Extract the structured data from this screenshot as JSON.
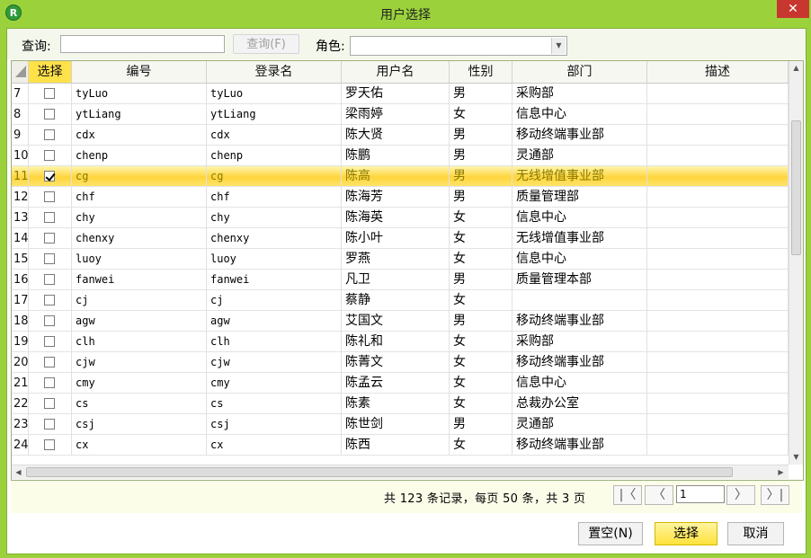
{
  "window": {
    "title": "用户选择",
    "close_glyph": "✕",
    "app_icon_glyph": "R"
  },
  "toolbar": {
    "query_label": "查询:",
    "query_value": "",
    "query_button": "查询(F)",
    "role_label": "角色:",
    "role_value": ""
  },
  "grid": {
    "columns": [
      "选择",
      "编号",
      "登录名",
      "用户名",
      "性别",
      "部门",
      "描述"
    ],
    "rows": [
      {
        "idx": "7",
        "checked": false,
        "id": "tyLuo",
        "login": "tyLuo",
        "name": "罗天佑",
        "gender": "男",
        "dept": "采购部",
        "desc": ""
      },
      {
        "idx": "8",
        "checked": false,
        "id": "ytLiang",
        "login": "ytLiang",
        "name": "梁雨婷",
        "gender": "女",
        "dept": "信息中心",
        "desc": ""
      },
      {
        "idx": "9",
        "checked": false,
        "id": "cdx",
        "login": "cdx",
        "name": "陈大贤",
        "gender": "男",
        "dept": "移动终端事业部",
        "desc": ""
      },
      {
        "idx": "10",
        "checked": false,
        "id": "chenp",
        "login": "chenp",
        "name": "陈鹏",
        "gender": "男",
        "dept": "灵通部",
        "desc": ""
      },
      {
        "idx": "11",
        "checked": true,
        "selected": true,
        "id": "cg",
        "login": "cg",
        "name": "陈高",
        "gender": "男",
        "dept": "无线增值事业部",
        "desc": ""
      },
      {
        "idx": "12",
        "checked": false,
        "id": "chf",
        "login": "chf",
        "name": "陈海芳",
        "gender": "男",
        "dept": "质量管理部",
        "desc": ""
      },
      {
        "idx": "13",
        "checked": false,
        "id": "chy",
        "login": "chy",
        "name": "陈海英",
        "gender": "女",
        "dept": "信息中心",
        "desc": ""
      },
      {
        "idx": "14",
        "checked": false,
        "id": "chenxy",
        "login": "chenxy",
        "name": "陈小叶",
        "gender": "女",
        "dept": "无线增值事业部",
        "desc": ""
      },
      {
        "idx": "15",
        "checked": false,
        "id": "luoy",
        "login": "luoy",
        "name": "罗燕",
        "gender": "女",
        "dept": "信息中心",
        "desc": ""
      },
      {
        "idx": "16",
        "checked": false,
        "id": "fanwei",
        "login": "fanwei",
        "name": "凡卫",
        "gender": "男",
        "dept": "质量管理本部",
        "desc": ""
      },
      {
        "idx": "17",
        "checked": false,
        "id": "cj",
        "login": "cj",
        "name": "蔡静",
        "gender": "女",
        "dept": "",
        "desc": ""
      },
      {
        "idx": "18",
        "checked": false,
        "id": "agw",
        "login": "agw",
        "name": "艾国文",
        "gender": "男",
        "dept": "移动终端事业部",
        "desc": ""
      },
      {
        "idx": "19",
        "checked": false,
        "id": "clh",
        "login": "clh",
        "name": "陈礼和",
        "gender": "女",
        "dept": "采购部",
        "desc": ""
      },
      {
        "idx": "20",
        "checked": false,
        "id": "cjw",
        "login": "cjw",
        "name": "陈菁文",
        "gender": "女",
        "dept": "移动终端事业部",
        "desc": ""
      },
      {
        "idx": "21",
        "checked": false,
        "id": "cmy",
        "login": "cmy",
        "name": "陈孟云",
        "gender": "女",
        "dept": "信息中心",
        "desc": ""
      },
      {
        "idx": "22",
        "checked": false,
        "id": "cs",
        "login": "cs",
        "name": "陈素",
        "gender": "女",
        "dept": "总裁办公室",
        "desc": ""
      },
      {
        "idx": "23",
        "checked": false,
        "id": "csj",
        "login": "csj",
        "name": "陈世剑",
        "gender": "男",
        "dept": "灵通部",
        "desc": ""
      },
      {
        "idx": "24",
        "checked": false,
        "id": "cx",
        "login": "cx",
        "name": "陈西",
        "gender": "女",
        "dept": "移动终端事业部",
        "desc": ""
      }
    ]
  },
  "pagination": {
    "summary": "共 123 条记录，每页 50 条，共 3 页",
    "current_page": "1",
    "first_glyph": "|〈",
    "prev_glyph": "〈",
    "next_glyph": "〉",
    "last_glyph": "〉|"
  },
  "buttons": {
    "clear": "置空(N)",
    "select": "选择",
    "cancel": "取消"
  },
  "colors": {
    "frame": "#9bd23c",
    "selected_row": "#ffd53c",
    "close": "#c7372f"
  }
}
